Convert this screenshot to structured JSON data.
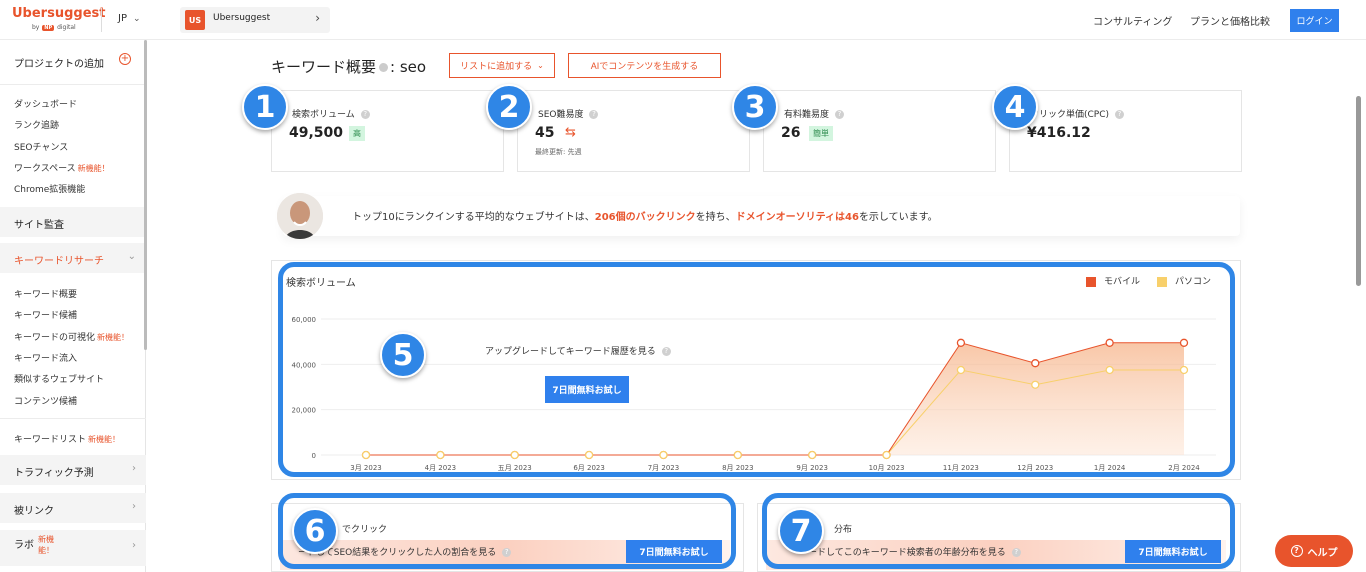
{
  "topbar": {
    "logo": "Ubersuggest",
    "logo_by": "by",
    "logo_np": "NP",
    "logo_digital": "digital",
    "lang": "JP",
    "project_badge": "US",
    "project_name": "Ubersuggest",
    "consulting": "コンサルティング",
    "pricing": "プランと価格比較",
    "login": "ログイン"
  },
  "sidebar": {
    "add_project": "プロジェクトの追加",
    "items_top": [
      "ダッシュボード",
      "ランク追跡",
      "SEOチャンス",
      "ワークスペース",
      "Chrome拡張機能"
    ],
    "new_label": "新機能！",
    "site_audit": "サイト監査",
    "keyword_research": "キーワードリサーチ",
    "kr_items": [
      "キーワード概要",
      "キーワード候補",
      "キーワードの可視化",
      "キーワード流入",
      "類似するウェブサイト",
      "コンテンツ候補"
    ],
    "keyword_list": "キーワードリスト",
    "new_label2": "新機能！",
    "traffic": "トラフィック予測",
    "backlinks": "被リンク",
    "labs": "ラボ",
    "labs_new1": "新機",
    "labs_new2": "能！"
  },
  "heading": {
    "title": "キーワード概要",
    "keyword": ": seo",
    "add_to_list": "リストに追加する",
    "ai_content": "AIでコンテンツを生成する"
  },
  "metrics": [
    {
      "label": "検索ボリューム",
      "value": "49,500",
      "badge": "高"
    },
    {
      "label": "SEO難易度",
      "value": "45",
      "sub": "最終更新: 先週"
    },
    {
      "label": "有料難易度",
      "value": "26",
      "badge": "簡単"
    },
    {
      "label": "クリック単価(CPC)",
      "value": "¥416.12"
    }
  ],
  "badges": [
    "1",
    "2",
    "3",
    "4",
    "5",
    "6",
    "7"
  ],
  "banner": {
    "pre": "トップ10にランクインする平均的なウェブサイトは、",
    "backlinks": "206個のバックリンク",
    "mid": "を持ち、",
    "da": "ドメインオーソリティは46",
    "post": "を示しています。"
  },
  "chart_data": {
    "type": "area",
    "title": "検索ボリューム",
    "categories": [
      "3月 2023",
      "4月 2023",
      "五月 2023",
      "6月 2023",
      "7月 2023",
      "8月 2023",
      "9月 2023",
      "10月 2023",
      "11月 2023",
      "12月 2023",
      "1月 2024",
      "2月 2024"
    ],
    "series": [
      {
        "name": "モバイル",
        "color": "#e8542c",
        "values": [
          0,
          0,
          0,
          0,
          0,
          0,
          0,
          0,
          49500,
          40500,
          49500,
          49500
        ]
      },
      {
        "name": "パソコン",
        "color": "#f8d06b",
        "values": [
          0,
          0,
          0,
          0,
          0,
          0,
          0,
          0,
          37500,
          31000,
          37500,
          37500
        ]
      }
    ],
    "yticks": [
      "0",
      "20,000",
      "40,000",
      "60,000"
    ],
    "ylim": [
      0,
      60000
    ],
    "grid": true,
    "legend": "top-right"
  },
  "chart_overlay": {
    "upgrade": "アップグレードしてキーワード履歴を見る",
    "trial": "7日間無料お試し"
  },
  "bottom": {
    "left_title": "でクリック",
    "left_text": "ードしてSEO結果をクリックした人の割合を見る",
    "right_title": "分布",
    "right_text": "ードしてこのキーワード検索者の年齢分布を見る",
    "trial": "7日間無料お試し"
  },
  "help": "ヘルプ"
}
